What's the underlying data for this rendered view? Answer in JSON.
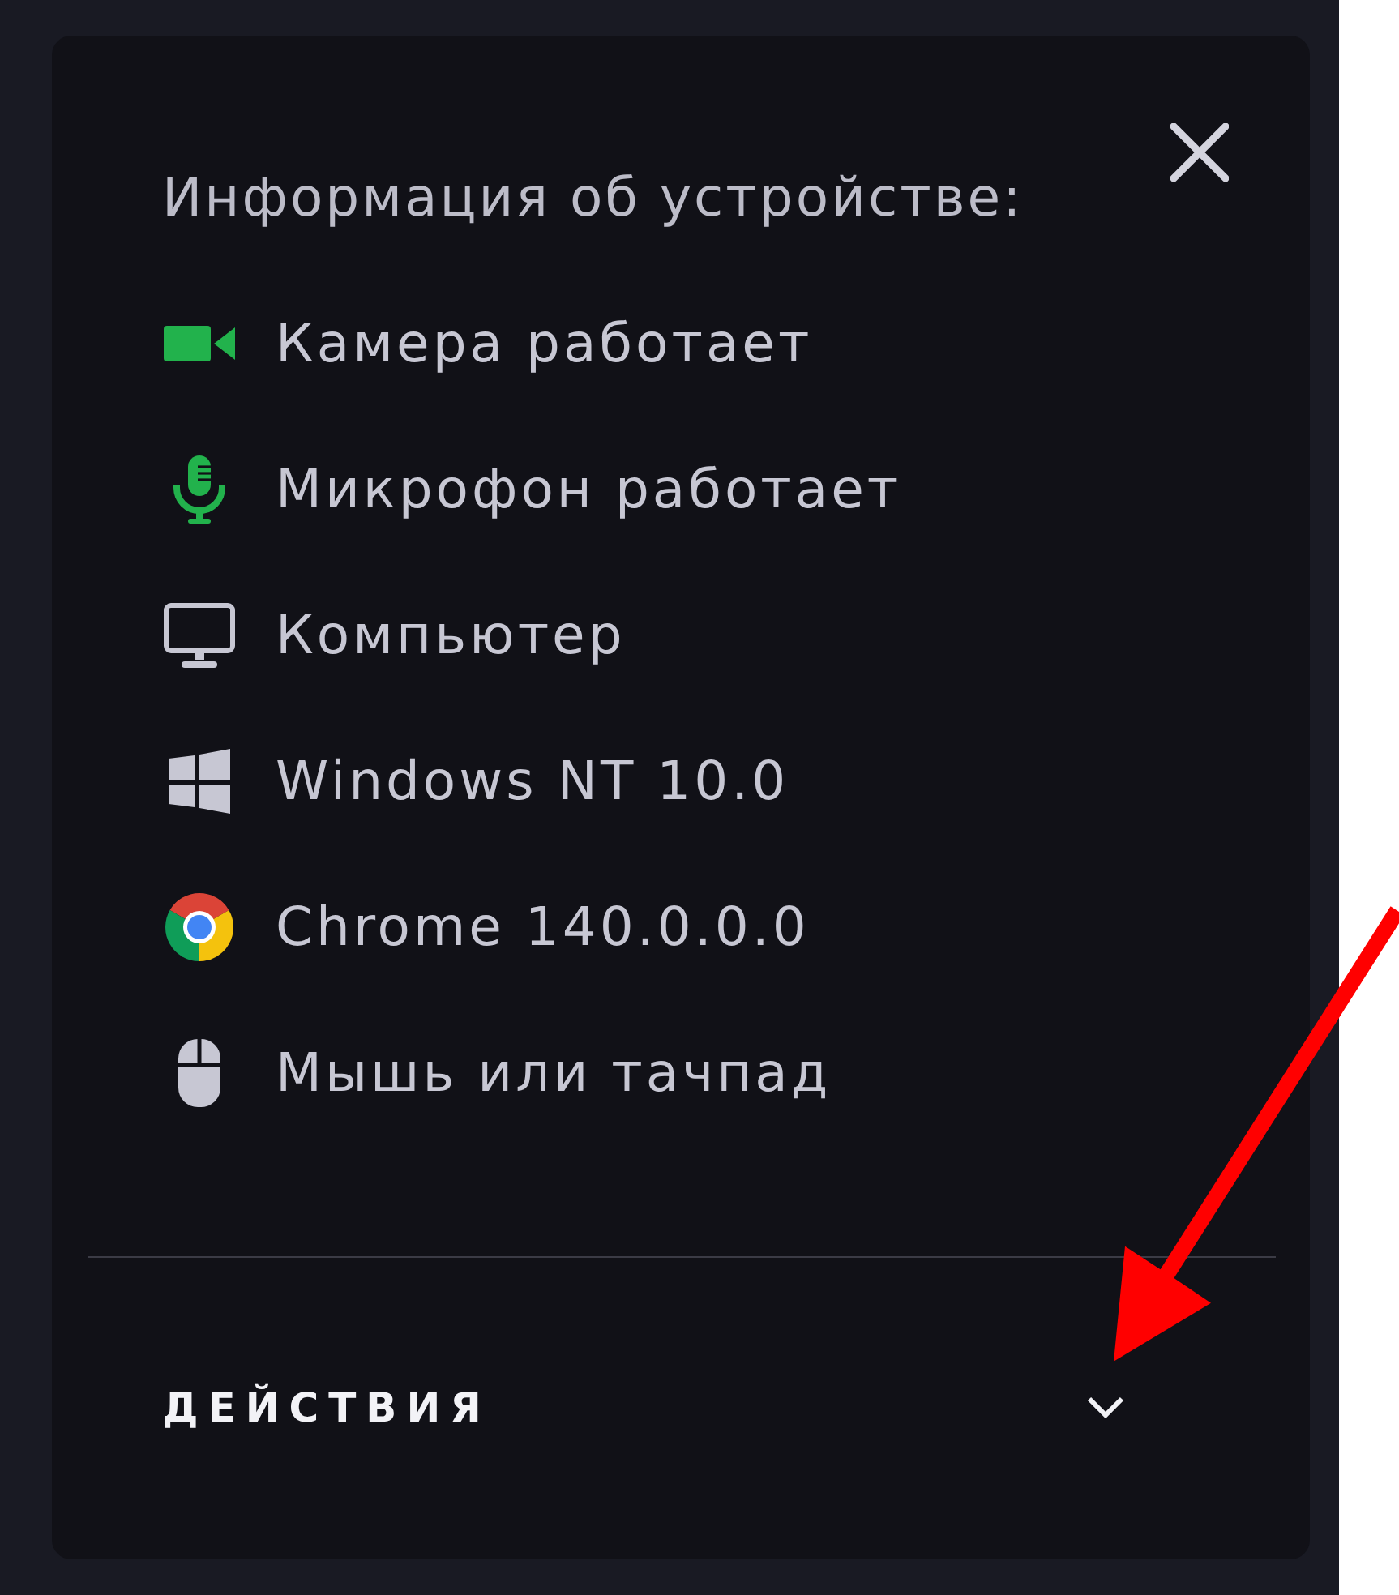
{
  "panel": {
    "title": "Информация об устройстве:",
    "items": [
      {
        "kind": "camera",
        "label": "Камера работает",
        "working": true
      },
      {
        "kind": "microphone",
        "label": "Микрофон работает",
        "working": true
      },
      {
        "kind": "computer",
        "label": "Компьютер"
      },
      {
        "kind": "os",
        "label": "Windows NT 10.0"
      },
      {
        "kind": "browser",
        "label": "Chrome 140.0.0.0"
      },
      {
        "kind": "pointer",
        "label": "Мышь или тачпад"
      }
    ],
    "actions": {
      "label": "ДЕЙСТВИЯ",
      "expanded": false
    }
  }
}
